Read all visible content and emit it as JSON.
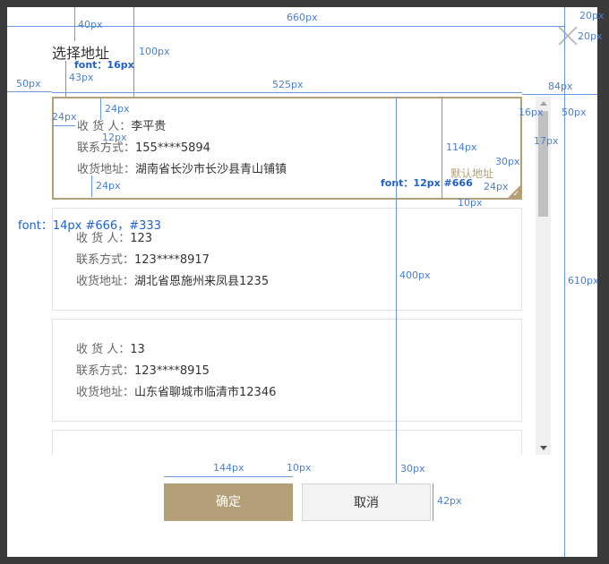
{
  "dialog": {
    "title": "选择地址",
    "confirm_label": "确定",
    "cancel_label": "取消",
    "default_tag": "默认地址"
  },
  "labels": {
    "recipient": "收 货 人：",
    "contact": "联系方式：",
    "address": "收货地址："
  },
  "addresses": [
    {
      "name": "李平贵",
      "phone": "155****5894",
      "address": "湖南省长沙市长沙县青山铺镇",
      "selected": true,
      "is_default": true
    },
    {
      "name": "123",
      "phone": "123****8917",
      "address": "湖北省恩施州来凤县1235",
      "selected": false
    },
    {
      "name": "13",
      "phone": "123****8915",
      "address": "山东省聊城市临清市12346",
      "selected": false
    }
  ],
  "annotations": {
    "w660": "660px",
    "h20a": "20px",
    "h20b": "20px",
    "w40": "40px",
    "h100": "100px",
    "font16": "font：16px",
    "h43": "43px",
    "w50": "50px",
    "w525": "525px",
    "w84": "84px",
    "w24a": "24px",
    "h24b": "24px",
    "h12": "12px",
    "h24c": "24px",
    "w16": "16px",
    "w50b": "50px",
    "w17": "17px",
    "h114": "114px",
    "w30": "30px",
    "w24d": "24px",
    "h10": "10px",
    "font12": "font：12px  #666",
    "font14": "font：14px   #666，#333",
    "h400": "400px",
    "h610": "610px",
    "w144": "144px",
    "w10": "10px",
    "h30": "30px",
    "h42": "42px"
  },
  "colors": {
    "accent": "#b4a078",
    "label": "#666666",
    "value": "#333333",
    "annotation": "#4a7fd0"
  }
}
